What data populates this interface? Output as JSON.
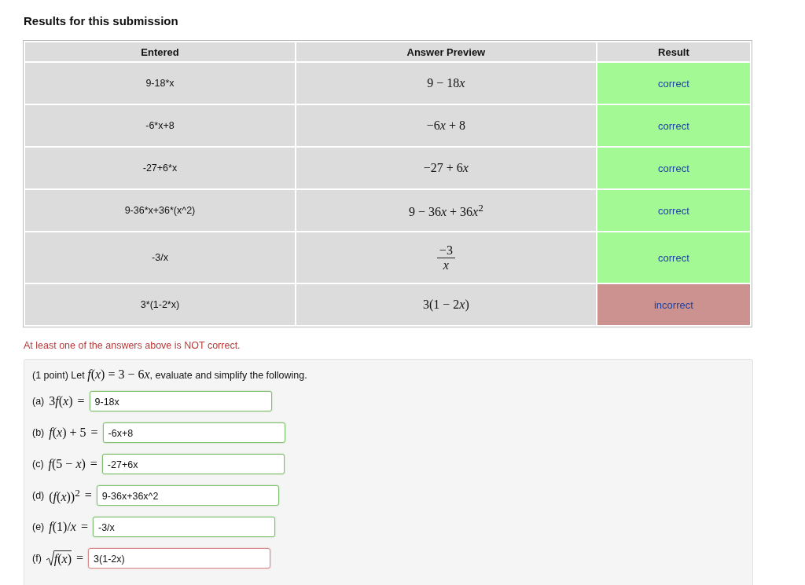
{
  "title": "Results for this submission",
  "table": {
    "columns": [
      "Entered",
      "Answer Preview",
      "Result"
    ],
    "rows": [
      {
        "entered": "9-18*x",
        "preview": {
          "kind": "inline",
          "text": "9 − 18x"
        },
        "result": "correct",
        "correct": true
      },
      {
        "entered": "-6*x+8",
        "preview": {
          "kind": "inline",
          "text": "−6x + 8"
        },
        "result": "correct",
        "correct": true
      },
      {
        "entered": "-27+6*x",
        "preview": {
          "kind": "inline",
          "text": "−27 + 6x"
        },
        "result": "correct",
        "correct": true
      },
      {
        "entered": "9-36*x+36*(x^2)",
        "preview": {
          "kind": "inline",
          "text": "9 − 36x + 36x$^{2}$"
        },
        "result": "correct",
        "correct": true
      },
      {
        "entered": "-3/x",
        "preview": {
          "kind": "fraction",
          "numerator": "−3",
          "denominator": "x"
        },
        "result": "correct",
        "correct": true
      },
      {
        "entered": "3*(1-2*x)",
        "preview": {
          "kind": "inline",
          "text": "3(1 − 2x)"
        },
        "result": "incorrect",
        "correct": false
      }
    ]
  },
  "message": "At least one of the answers above is NOT correct.",
  "problem": {
    "lead": "(1 point) Let",
    "math": "f(x) = 3 − 6x",
    "tail": ", evaluate and simplify the following.",
    "parts": [
      {
        "label": "(a)",
        "kind": "plain",
        "math": "3f(x)",
        "equals": "=",
        "value": "9-18x",
        "correct": true
      },
      {
        "label": "(b)",
        "kind": "plain",
        "math": "f(x) + 5",
        "equals": "=",
        "value": "-6x+8",
        "correct": true
      },
      {
        "label": "(c)",
        "kind": "plain",
        "math": "f(5 − x)",
        "equals": "=",
        "value": "-27+6x",
        "correct": true
      },
      {
        "label": "(d)",
        "kind": "plain",
        "math": "(f(x))$^{2}$",
        "equals": "=",
        "value": "9-36x+36x^2",
        "correct": true
      },
      {
        "label": "(e)",
        "kind": "plain",
        "math": "f(1)/x",
        "equals": "=",
        "value": "-3/x",
        "correct": true
      },
      {
        "label": "(f)",
        "kind": "sqrt",
        "math": "f(x)",
        "equals": "=",
        "value": "3(1-2x)",
        "correct": false
      }
    ]
  }
}
